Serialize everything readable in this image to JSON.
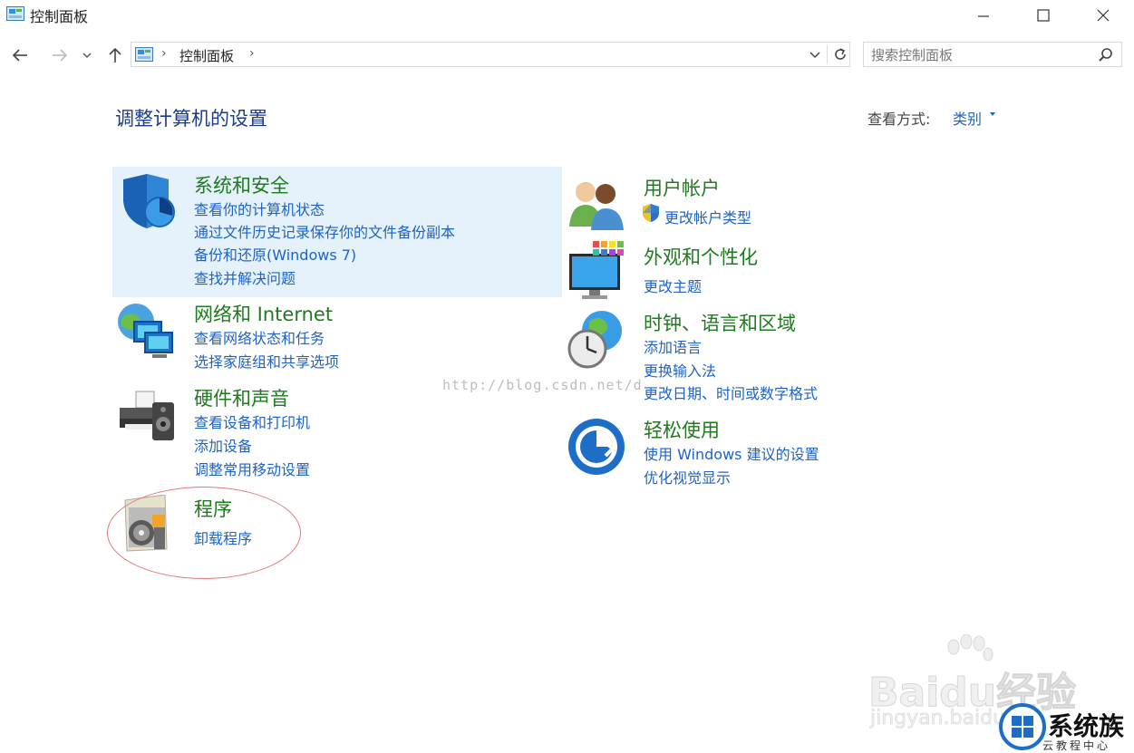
{
  "window": {
    "title": "控制面板"
  },
  "address": {
    "crumb": "控制面板"
  },
  "search": {
    "placeholder": "搜索控制面板"
  },
  "header": {
    "title": "调整计算机的设置",
    "view_label": "查看方式:",
    "view_value": "类别"
  },
  "categories": [
    {
      "title": "系统和安全",
      "links": [
        "查看你的计算机状态",
        "通过文件历史记录保存你的文件备份副本",
        "备份和还原(Windows 7)",
        "查找并解决问题"
      ]
    },
    {
      "title": "网络和 Internet",
      "links": [
        "查看网络状态和任务",
        "选择家庭组和共享选项"
      ]
    },
    {
      "title": "硬件和声音",
      "links": [
        "查看设备和打印机",
        "添加设备",
        "调整常用移动设置"
      ]
    },
    {
      "title": "程序",
      "links": [
        "卸载程序"
      ]
    },
    {
      "title": "用户帐户",
      "links": [
        "更改帐户类型"
      ]
    },
    {
      "title": "外观和个性化",
      "links": [
        "更改主题"
      ]
    },
    {
      "title": "时钟、语言和区域",
      "links": [
        "添加语言",
        "更换输入法",
        "更改日期、时间或数字格式"
      ]
    },
    {
      "title": "轻松使用",
      "links": [
        "使用 Windows 建议的设置",
        "优化视觉显示"
      ]
    }
  ],
  "watermarks": {
    "url": "http://blog.csdn.net/d",
    "baidu": "Baidu经验",
    "baidu_sub": "jingyan.baidu",
    "brand": "系统族",
    "brand_sub": "云教程中心"
  },
  "icons": {
    "title": "control-panel-icon",
    "minimize": "minimize-icon",
    "maximize": "maximize-icon",
    "close": "close-icon",
    "back": "arrow-left-icon",
    "forward": "arrow-right-icon",
    "recent": "chevron-down-icon",
    "up": "arrow-up-icon",
    "refresh": "refresh-icon",
    "search": "search-icon"
  },
  "colors": {
    "category_title": "#1e7b1e",
    "link": "#1e63c6",
    "heading": "#1a3c8a",
    "highlight": "#e5f1fb",
    "annotation": "#e07a7a"
  }
}
